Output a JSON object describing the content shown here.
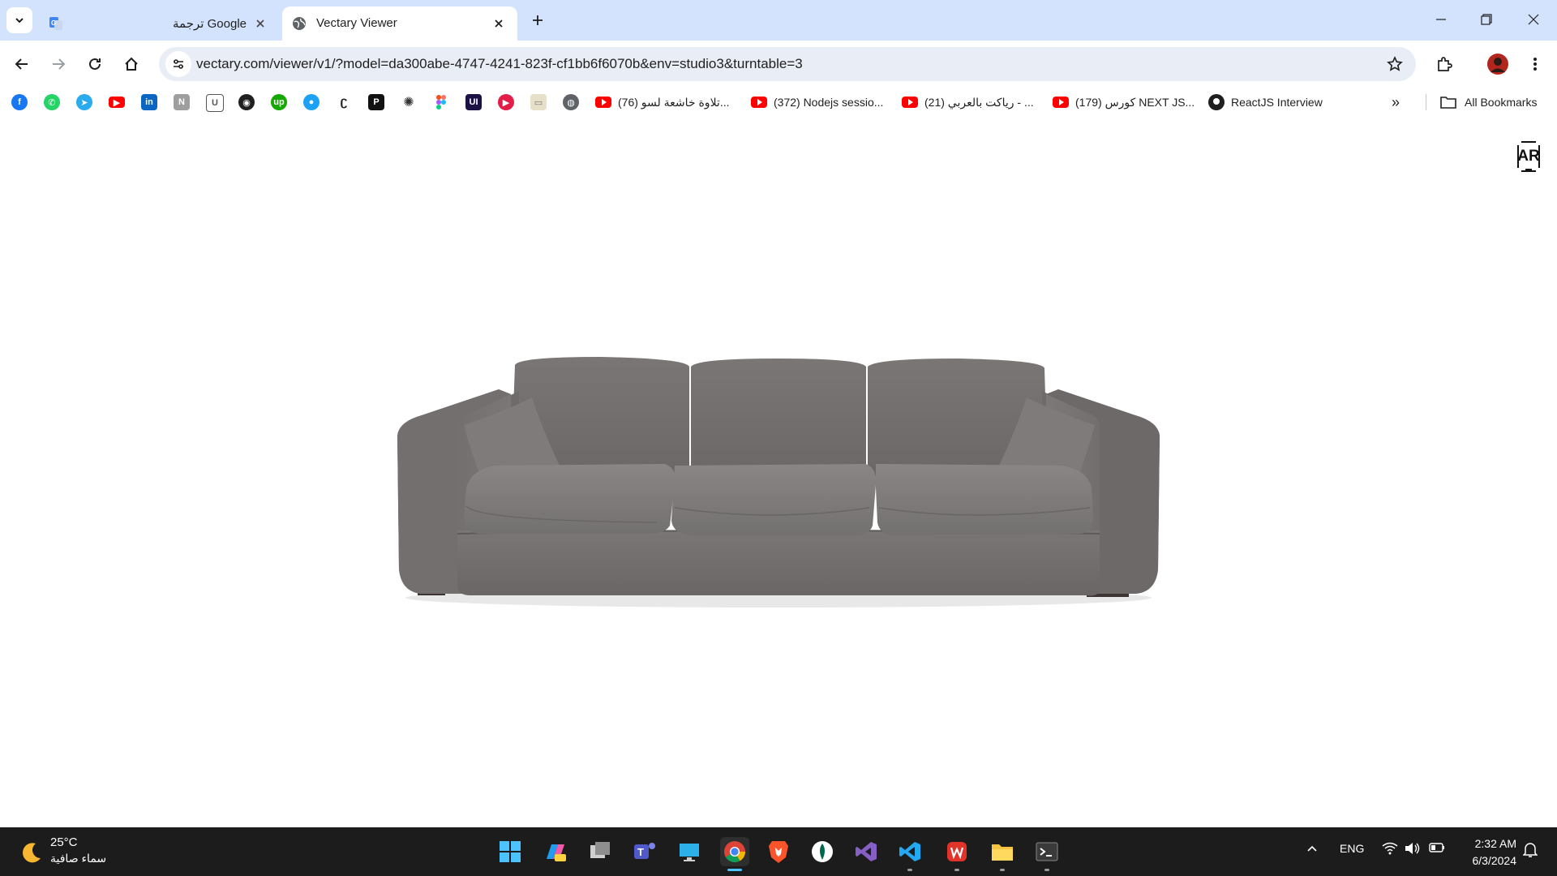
{
  "tabs": [
    {
      "title": "ترجمة Google",
      "icon": "google-translate-icon",
      "active": false
    },
    {
      "title": "Vectary Viewer",
      "icon": "globe-icon",
      "active": true
    }
  ],
  "toolbar": {
    "url": "vectary.com/viewer/v1/?model=da300abe-4747-4241-823f-cf1bb6f6070b&env=studio3&turntable=3"
  },
  "bookmarks": {
    "icons": [
      "facebook-icon",
      "whatsapp-icon",
      "telegram-icon",
      "youtube-icon",
      "linkedin-icon",
      "notion-icon",
      "shield-icon",
      "github-icon",
      "upwork-icon",
      "circle-app-icon",
      "codepen-icon",
      "producthunt-icon",
      "openai-icon",
      "figma-icon",
      "uiverse-icon",
      "play-icon",
      "image-icon",
      "globe-icon"
    ],
    "items": [
      {
        "label": "(76) تلاوة خاشعة لسو...",
        "icon": "youtube-icon"
      },
      {
        "label": "(372) Nodejs sessio...",
        "icon": "youtube-icon"
      },
      {
        "label": "(21) رياكت بالعربي - ...",
        "icon": "youtube-icon"
      },
      {
        "label": "(179) كورس NEXT JS...",
        "icon": "youtube-icon"
      },
      {
        "label": "ReactJS Interview",
        "icon": "github-icon"
      }
    ],
    "all_bookmarks": "All Bookmarks"
  },
  "viewer": {
    "ar_label": "AR",
    "sofa_color": "#757170"
  },
  "taskbar": {
    "weather": {
      "temp": "25°C",
      "condition": "سماء صافية"
    },
    "apps": [
      "start-icon",
      "copilot-icon",
      "task-view-icon",
      "teams-icon",
      "desktop-icon",
      "chrome-icon",
      "brave-icon",
      "mongodb-compass-icon",
      "visual-studio-icon",
      "vscode-icon",
      "wps-icon",
      "file-explorer-icon",
      "terminal-icon"
    ],
    "language": "ENG",
    "time": "2:32 AM",
    "date": "6/3/2024"
  }
}
